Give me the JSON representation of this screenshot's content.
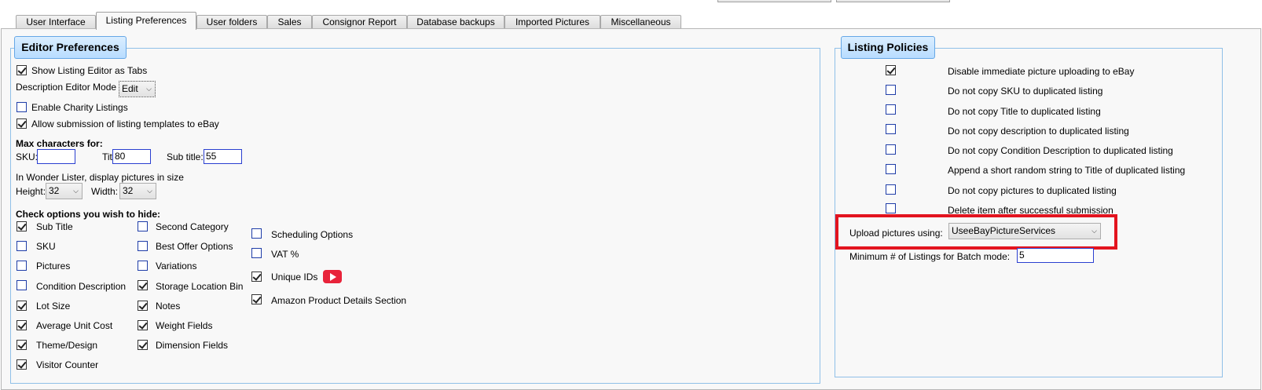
{
  "tabs": [
    "User Interface",
    "Listing Preferences",
    "User folders",
    "Sales",
    "Consignor Report",
    "Database backups",
    "Imported Pictures",
    "Miscellaneous"
  ],
  "editor": {
    "title": "Editor Preferences",
    "show_tabs": "Show Listing Editor as Tabs",
    "desc_mode_label": "Description Editor Mode",
    "desc_mode_value": "Edit",
    "charity": "Enable Charity Listings",
    "allow_templates": "Allow submission of listing templates to eBay",
    "max_chars": "Max characters for:",
    "sku_label": "SKU:",
    "sku_value": "",
    "title_label": "Title:",
    "title_value": "80",
    "subtitle_label": "Sub title:",
    "subtitle_value": "55",
    "pic_size_label": "In Wonder Lister, display pictures in size",
    "height_label": "Height:",
    "height_value": "32",
    "width_label": "Width:",
    "width_value": "32",
    "hide_label": "Check options you wish to hide:",
    "col1": [
      {
        "label": "Sub Title",
        "checked": true
      },
      {
        "label": "SKU",
        "checked": false
      },
      {
        "label": "Pictures",
        "checked": false
      },
      {
        "label": "Condition Description",
        "checked": false
      },
      {
        "label": "Lot Size",
        "checked": true
      },
      {
        "label": "Average Unit Cost",
        "checked": true
      },
      {
        "label": "Theme/Design",
        "checked": true
      },
      {
        "label": "Visitor Counter",
        "checked": true
      }
    ],
    "col2": [
      {
        "label": "Second Category",
        "checked": false
      },
      {
        "label": "Best Offer Options",
        "checked": false
      },
      {
        "label": "Variations",
        "checked": false
      },
      {
        "label": "Storage Location Bin",
        "checked": true
      },
      {
        "label": "Notes",
        "checked": true
      },
      {
        "label": "Weight Fields",
        "checked": true
      },
      {
        "label": "Dimension Fields",
        "checked": true
      }
    ],
    "col3": [
      {
        "label": "Scheduling Options",
        "checked": false
      },
      {
        "label": "VAT %",
        "checked": false
      },
      {
        "label": "Unique IDs",
        "checked": true
      },
      {
        "label": "Amazon Product Details Section",
        "checked": true
      }
    ]
  },
  "policies": {
    "title": "Listing Policies",
    "items": [
      {
        "label": "Disable immediate picture uploading to eBay",
        "checked": true
      },
      {
        "label": "Do not copy SKU to duplicated listing",
        "checked": false
      },
      {
        "label": "Do not copy Title to duplicated listing",
        "checked": false
      },
      {
        "label": "Do not copy description to duplicated listing",
        "checked": false
      },
      {
        "label": "Do not copy Condition Description to duplicated listing",
        "checked": false
      },
      {
        "label": "Append a short random string to Title of duplicated listing",
        "checked": false
      },
      {
        "label": "Do not copy pictures to duplicated listing",
        "checked": false
      },
      {
        "label": "Delete item after successful submission",
        "checked": false
      }
    ],
    "upload_label": "Upload pictures using:",
    "upload_value": "UseeBayPictureServices",
    "min_batch_label": "Minimum # of Listings for Batch mode:",
    "min_batch_value": "5"
  },
  "colors": {
    "highlight": "#e3141f",
    "group_border": "#90c0e8",
    "input_border": "#2a3fd0"
  }
}
